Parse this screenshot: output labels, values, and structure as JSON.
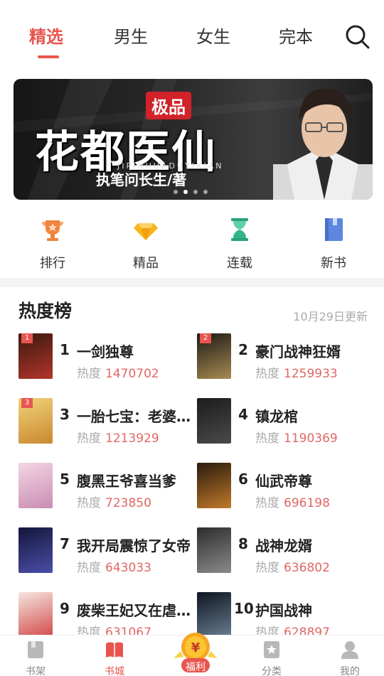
{
  "top_tabs": [
    {
      "label": "精选",
      "active": true
    },
    {
      "label": "男生",
      "active": false
    },
    {
      "label": "女生",
      "active": false
    },
    {
      "label": "完本",
      "active": false
    }
  ],
  "banner": {
    "tag": "极品",
    "title": "花都医仙",
    "pinyin": "JIPINHUADUYIXIAN",
    "author": "执笔问长生/著",
    "active_dot": 1,
    "dot_count": 4
  },
  "quick_nav": [
    {
      "label": "排行",
      "icon": "trophy-icon",
      "color": "#f0843e"
    },
    {
      "label": "精品",
      "icon": "diamond-icon",
      "color": "#f8b31d"
    },
    {
      "label": "连载",
      "icon": "hourglass-icon",
      "color": "#32b58b"
    },
    {
      "label": "新书",
      "icon": "book-icon",
      "color": "#5e86de"
    }
  ],
  "rank": {
    "title": "热度榜",
    "date": "10月29日更新",
    "heat_label": "热度",
    "items": [
      {
        "rank": "1",
        "name": "一剑独尊",
        "heat": "1470702",
        "badge": "1",
        "cover_colors": [
          "#3a1a10",
          "#b3342a"
        ]
      },
      {
        "rank": "2",
        "name": "豪门战神狂婿",
        "heat": "1259933",
        "badge": "2",
        "cover_colors": [
          "#1d1a16",
          "#a88a52"
        ]
      },
      {
        "rank": "3",
        "name": "一胎七宝：老婆…",
        "heat": "1213929",
        "badge": "3",
        "cover_colors": [
          "#f1d37a",
          "#c9882e"
        ]
      },
      {
        "rank": "4",
        "name": "镇龙棺",
        "heat": "1190369",
        "badge": "",
        "cover_colors": [
          "#1c1c1c",
          "#4a4a4a"
        ]
      },
      {
        "rank": "5",
        "name": "腹黑王爷喜当爹",
        "heat": "723850",
        "badge": "",
        "cover_colors": [
          "#f3d6e4",
          "#c98db3"
        ]
      },
      {
        "rank": "6",
        "name": "仙武帝尊",
        "heat": "696198",
        "badge": "",
        "cover_colors": [
          "#2a1a0e",
          "#c07a2a"
        ]
      },
      {
        "rank": "7",
        "name": "我开局震惊了女帝",
        "heat": "643033",
        "badge": "",
        "cover_colors": [
          "#14163a",
          "#4a4ea8"
        ]
      },
      {
        "rank": "8",
        "name": "战神龙婿",
        "heat": "636802",
        "badge": "",
        "cover_colors": [
          "#2d2d2d",
          "#8a8a8a"
        ]
      },
      {
        "rank": "9",
        "name": "废柴王妃又在虐…",
        "heat": "631067",
        "badge": "",
        "cover_colors": [
          "#f6e6e0",
          "#d14848"
        ]
      },
      {
        "rank": "10",
        "name": "护国战神",
        "heat": "628897",
        "badge": "",
        "cover_colors": [
          "#0d1520",
          "#6a7e93"
        ]
      }
    ]
  },
  "bottom_nav": [
    {
      "label": "书架",
      "icon": "bookshelf-icon",
      "active": false
    },
    {
      "label": "书城",
      "icon": "bookstore-icon",
      "active": true
    },
    {
      "label": "福利",
      "icon": "coin-icon",
      "active": false
    },
    {
      "label": "分类",
      "icon": "category-icon",
      "active": false
    },
    {
      "label": "我的",
      "icon": "profile-icon",
      "active": false
    }
  ],
  "colors": {
    "accent": "#e8554e",
    "heat_value": "#e06763"
  }
}
